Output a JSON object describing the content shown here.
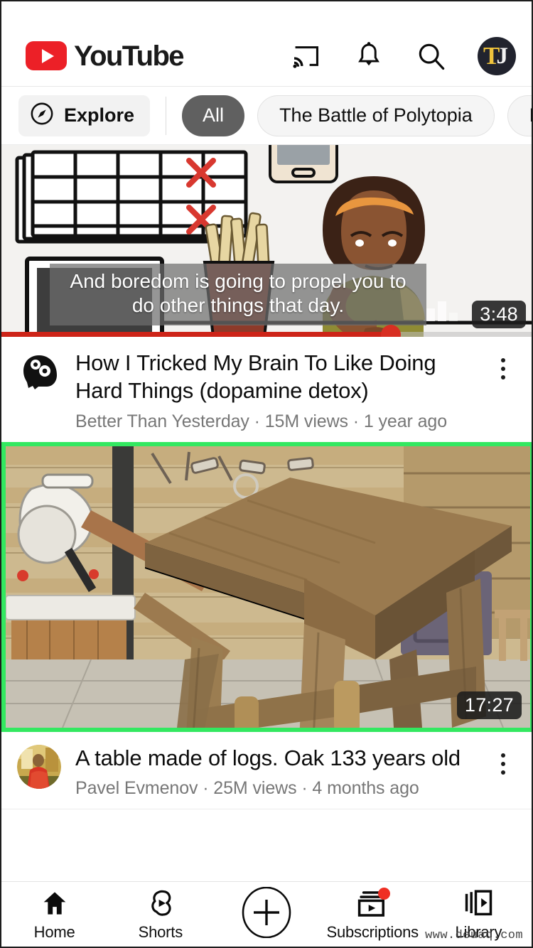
{
  "app": {
    "brand": "YouTube"
  },
  "header": {
    "icons": [
      {
        "name": "cast-icon",
        "label": "Cast"
      },
      {
        "name": "bell-icon",
        "label": "Notifications"
      },
      {
        "name": "search-icon",
        "label": "Search"
      }
    ],
    "avatar": {
      "name": "account-avatar",
      "initial_primary": "T",
      "initial_secondary": "J",
      "bg": "#21232e",
      "fg": "#efc33c"
    }
  },
  "chips": {
    "explore": {
      "label": "Explore",
      "icon": "compass-icon"
    },
    "items": [
      {
        "label": "All",
        "active": true
      },
      {
        "label": "The Battle of Polytopia",
        "active": false
      },
      {
        "label": "R",
        "active": false
      }
    ]
  },
  "videos": [
    {
      "title": "How I Tricked My Brain To Like Doing Hard Things (dopamine detox)",
      "channel": "Better Than Yesterday",
      "views": "15M views",
      "age": "1 year ago",
      "meta_line": "Better Than Yesterday · 15M views · 1 year ago",
      "duration": "3:48",
      "caption": "And boredom is going to propel you to do other things that day.",
      "progress_percent": 73,
      "highlighted": false,
      "avatar_type": "head-gears-icon"
    },
    {
      "title": "A table made of logs. Oak 133 years old",
      "channel": "Pavel Evmenov",
      "views": "25M views",
      "age": "4 months ago",
      "meta_line": "Pavel Evmenov · 25M views · 4 months ago",
      "duration": "17:27",
      "caption": "",
      "progress_percent": 0,
      "highlighted": true,
      "avatar_type": "photo-avatar"
    }
  ],
  "bottom_nav": {
    "items": [
      {
        "label": "Home",
        "icon": "home-icon",
        "badge": false,
        "active": true
      },
      {
        "label": "Shorts",
        "icon": "shorts-icon",
        "badge": false,
        "active": false
      },
      {
        "label": "",
        "icon": "create-plus-icon",
        "badge": false,
        "active": false
      },
      {
        "label": "Subscriptions",
        "icon": "subscriptions-icon",
        "badge": true,
        "active": false
      },
      {
        "label": "Library",
        "icon": "library-icon",
        "badge": false,
        "active": false
      }
    ]
  },
  "watermark": "www.deuaq.com",
  "colors": {
    "brand_red": "#ec2027",
    "highlight_green": "#33e860",
    "chip_active_bg": "#606060",
    "progress_red": "#cd2418"
  }
}
